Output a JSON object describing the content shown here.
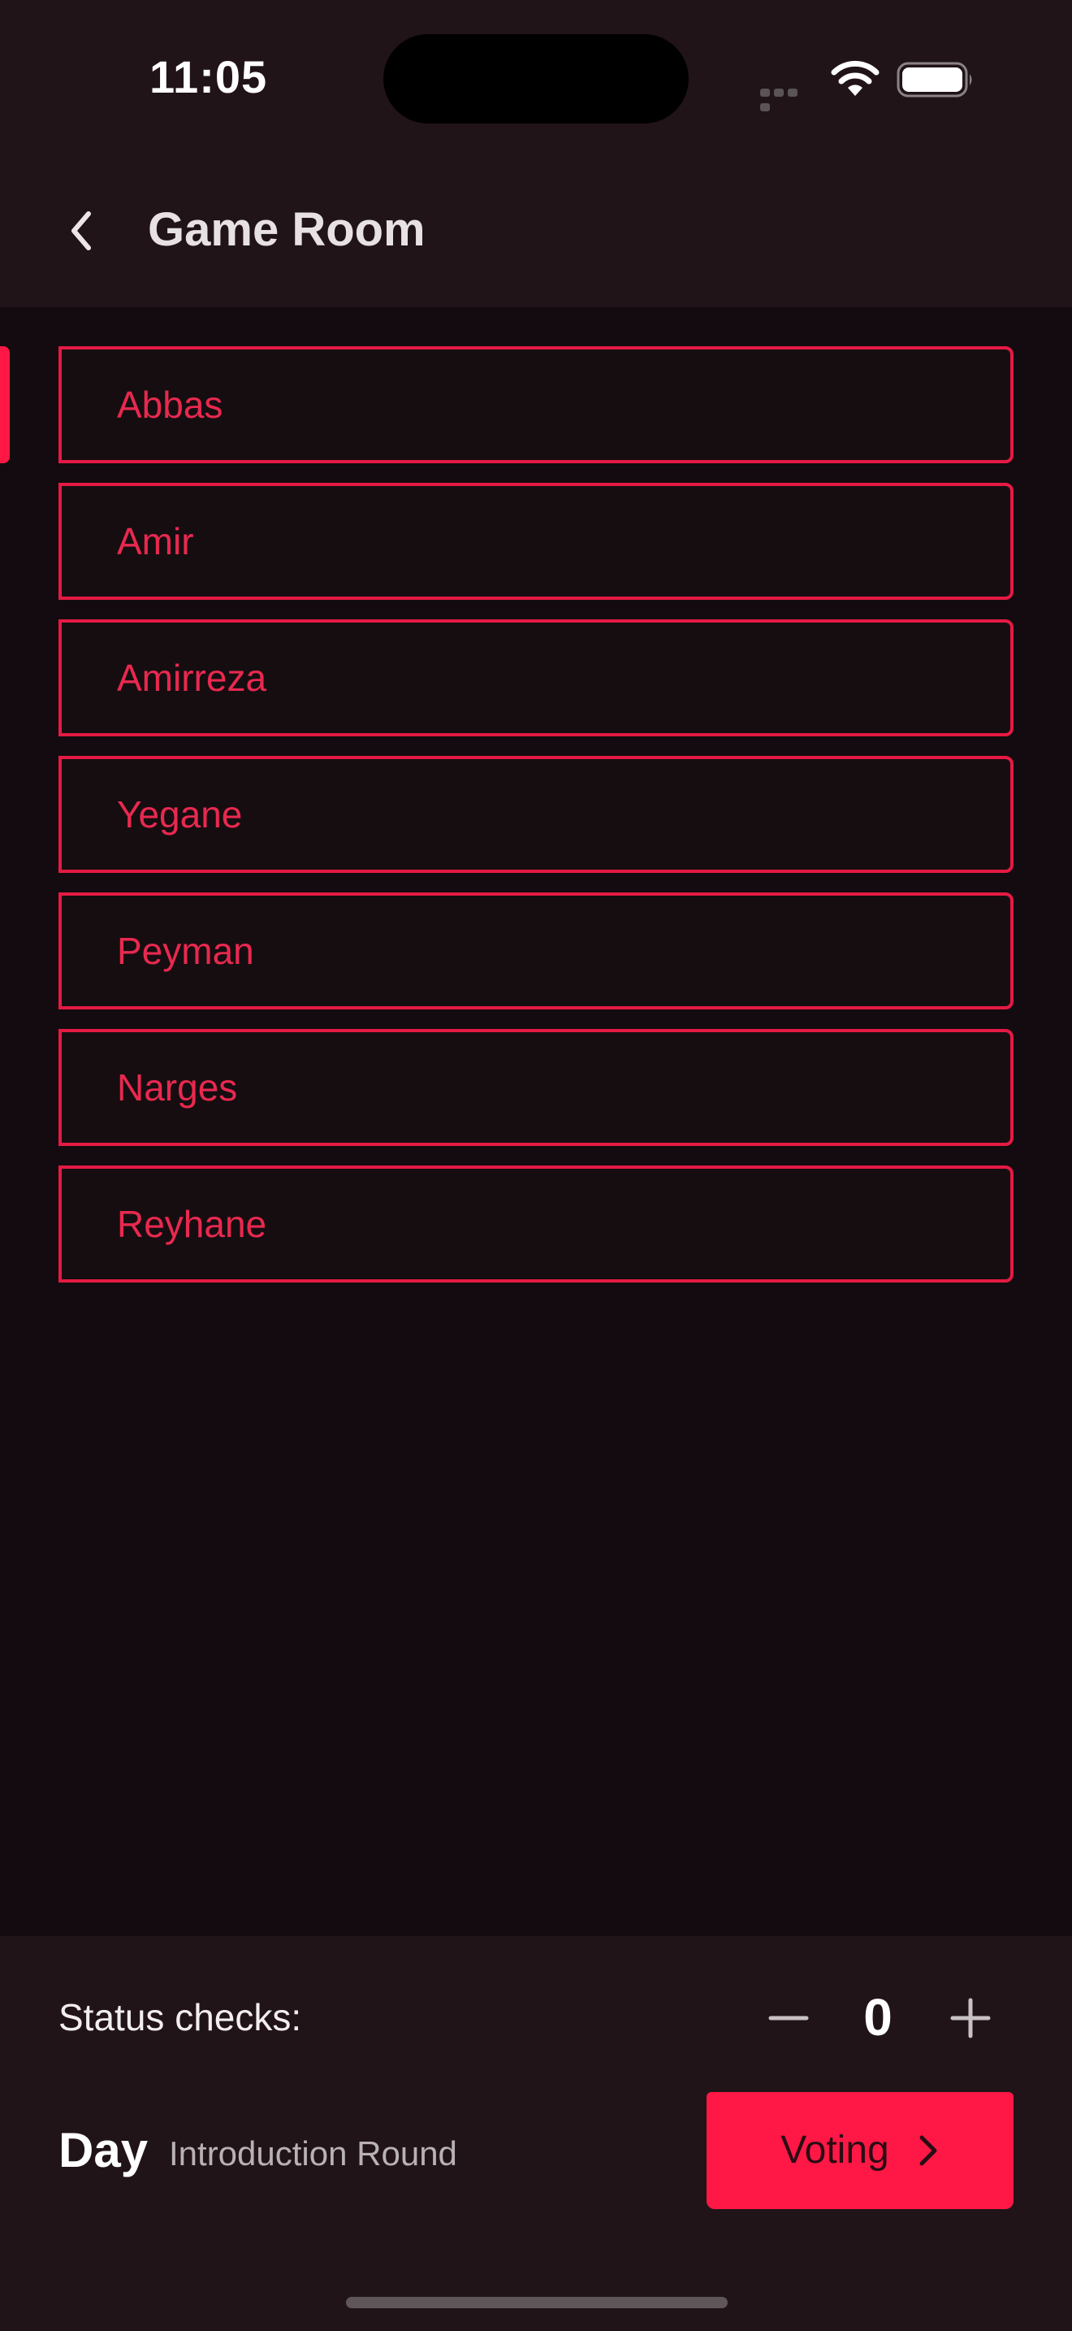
{
  "status_bar": {
    "time": "11:05",
    "icons": [
      "signal-icon",
      "wifi-icon",
      "battery-icon"
    ]
  },
  "header": {
    "back_icon": "chevron-left-icon",
    "title": "Game Room"
  },
  "players": [
    {
      "name": "Abbas"
    },
    {
      "name": "Amir"
    },
    {
      "name": "Amirreza"
    },
    {
      "name": "Yegane"
    },
    {
      "name": "Peyman"
    },
    {
      "name": "Narges"
    },
    {
      "name": "Reyhane"
    }
  ],
  "footer": {
    "status_checks_label": "Status checks:",
    "status_checks_value": "0",
    "decrement_icon": "minus-icon",
    "increment_icon": "plus-icon",
    "phase": "Day",
    "round": "Introduction Round",
    "next_button_label": "Voting",
    "next_button_icon": "chevron-right-icon"
  },
  "colors": {
    "accent": "#ff1846",
    "background": "#130b0f",
    "surface": "#211418"
  }
}
